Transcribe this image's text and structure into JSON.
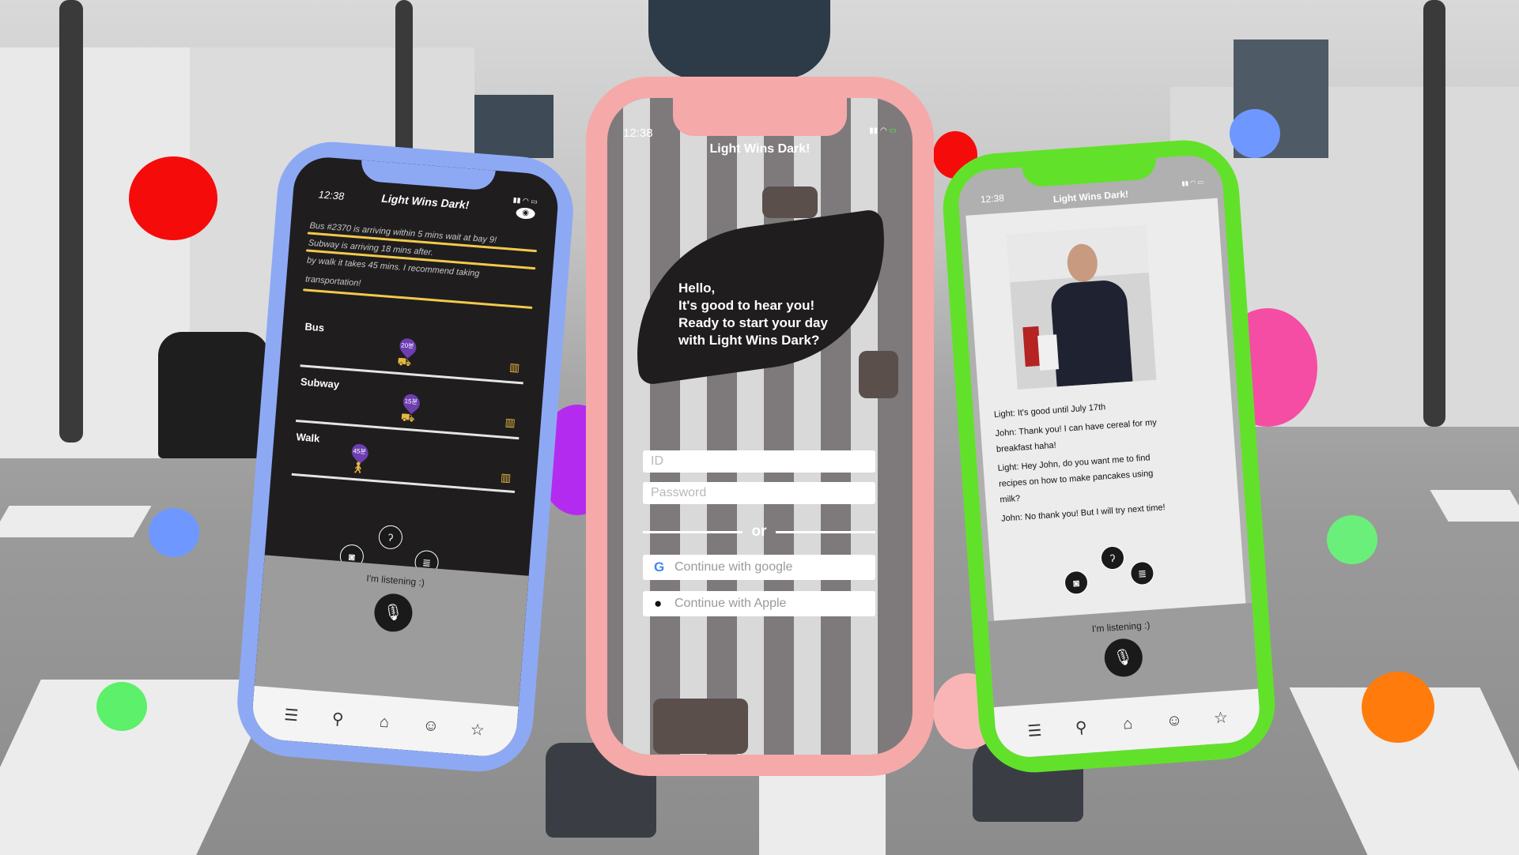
{
  "left_phone": {
    "time": "12:38",
    "title": "Light Wins Dark!",
    "messages": [
      "Bus #2370 is arriving within 5 mins wait at bay 9!",
      "Subway is arriving 18 mins after.",
      "by walk it takes 45 mins. I recommend taking",
      "transportation!"
    ],
    "routes": [
      {
        "label": "Bus",
        "badge": "20분"
      },
      {
        "label": "Subway",
        "badge": "15분"
      },
      {
        "label": "Walk",
        "badge": "45분"
      }
    ],
    "listening": "I'm listening :)"
  },
  "center_phone": {
    "time": "12:38",
    "title": "Light Wins Dark!",
    "greeting": [
      "Hello,",
      "It's good to hear you!",
      "Ready to start your day",
      "with Light Wins Dark?"
    ],
    "id_placeholder": "ID",
    "password_placeholder": "Password",
    "or_text": "or",
    "google_label": "Continue with google",
    "apple_label": "Continue with Apple"
  },
  "right_phone": {
    "time": "12:38",
    "title": "Light Wins Dark!",
    "messages": [
      "Light: It's good until July 17th",
      "John: Thank you! I can have cereal for my",
      "breakfast haha!",
      "Light: Hey John, do you want me to find",
      "recipes on how to make pancakes using",
      "milk?",
      "John: No thank you! But I will try next time!"
    ],
    "listening": "I'm listening :)"
  },
  "icons": [
    "menu-icon",
    "search-icon",
    "home-icon",
    "profile-icon",
    "star-icon",
    "camera-icon",
    "ear-icon",
    "note-icon",
    "mic-icon"
  ],
  "colors": {
    "left_phone_frame": "#8ea9f4",
    "center_phone_frame": "#f5a9a9",
    "right_phone_frame": "#62e12a",
    "accent_yellow": "#f2c94c",
    "badge_purple": "#6d3eb0"
  }
}
